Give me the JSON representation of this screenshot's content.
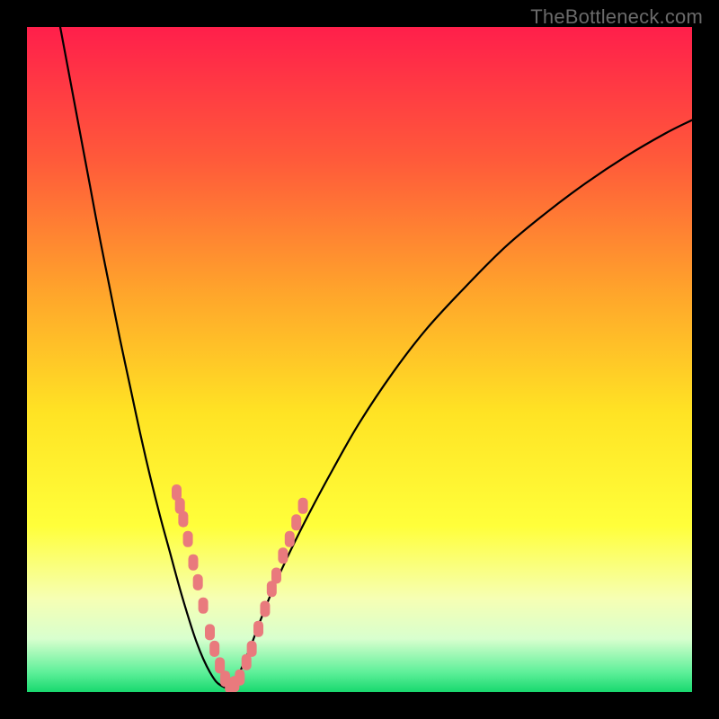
{
  "watermark": "TheBottleneck.com",
  "chart_data": {
    "type": "line",
    "title": "",
    "xlabel": "",
    "ylabel": "",
    "xlim": [
      0,
      100
    ],
    "ylim": [
      0,
      100
    ],
    "grid": false,
    "legend": false,
    "gradient_stops": [
      {
        "offset": 0.0,
        "color": "#ff1f4b"
      },
      {
        "offset": 0.2,
        "color": "#ff5a3a"
      },
      {
        "offset": 0.4,
        "color": "#ffa52b"
      },
      {
        "offset": 0.58,
        "color": "#ffe324"
      },
      {
        "offset": 0.75,
        "color": "#ffff3a"
      },
      {
        "offset": 0.86,
        "color": "#f6ffb4"
      },
      {
        "offset": 0.92,
        "color": "#d8ffce"
      },
      {
        "offset": 0.97,
        "color": "#5ff09a"
      },
      {
        "offset": 1.0,
        "color": "#18d86e"
      }
    ],
    "series": [
      {
        "name": "left-branch",
        "type": "line",
        "color": "#000000",
        "points": [
          {
            "x": 5.0,
            "y": 100.0
          },
          {
            "x": 6.5,
            "y": 92.0
          },
          {
            "x": 8.0,
            "y": 84.0
          },
          {
            "x": 9.5,
            "y": 76.0
          },
          {
            "x": 11.0,
            "y": 68.0
          },
          {
            "x": 12.5,
            "y": 60.5
          },
          {
            "x": 14.0,
            "y": 53.0
          },
          {
            "x": 15.5,
            "y": 46.0
          },
          {
            "x": 17.0,
            "y": 39.0
          },
          {
            "x": 18.5,
            "y": 32.5
          },
          {
            "x": 20.0,
            "y": 26.5
          },
          {
            "x": 21.5,
            "y": 21.0
          },
          {
            "x": 23.0,
            "y": 15.5
          },
          {
            "x": 24.5,
            "y": 10.5
          },
          {
            "x": 25.5,
            "y": 7.5
          },
          {
            "x": 26.5,
            "y": 5.0
          },
          {
            "x": 27.5,
            "y": 3.0
          },
          {
            "x": 28.5,
            "y": 1.5
          },
          {
            "x": 29.5,
            "y": 0.8
          },
          {
            "x": 30.2,
            "y": 0.5
          }
        ]
      },
      {
        "name": "right-branch",
        "type": "line",
        "color": "#000000",
        "points": [
          {
            "x": 30.2,
            "y": 0.5
          },
          {
            "x": 31.0,
            "y": 1.2
          },
          {
            "x": 32.0,
            "y": 3.0
          },
          {
            "x": 33.5,
            "y": 6.5
          },
          {
            "x": 35.0,
            "y": 10.5
          },
          {
            "x": 37.0,
            "y": 15.5
          },
          {
            "x": 39.5,
            "y": 21.0
          },
          {
            "x": 42.5,
            "y": 27.0
          },
          {
            "x": 46.0,
            "y": 33.5
          },
          {
            "x": 50.0,
            "y": 40.5
          },
          {
            "x": 55.0,
            "y": 48.0
          },
          {
            "x": 60.0,
            "y": 54.5
          },
          {
            "x": 66.0,
            "y": 61.0
          },
          {
            "x": 72.0,
            "y": 67.0
          },
          {
            "x": 78.0,
            "y": 72.0
          },
          {
            "x": 84.0,
            "y": 76.5
          },
          {
            "x": 90.0,
            "y": 80.5
          },
          {
            "x": 96.0,
            "y": 84.0
          },
          {
            "x": 100.0,
            "y": 86.0
          }
        ]
      },
      {
        "name": "highlight-markers",
        "type": "scatter",
        "color": "#e97a7d",
        "points": [
          {
            "x": 22.5,
            "y": 30.0
          },
          {
            "x": 23.0,
            "y": 28.0
          },
          {
            "x": 23.5,
            "y": 26.0
          },
          {
            "x": 24.2,
            "y": 23.0
          },
          {
            "x": 25.0,
            "y": 19.5
          },
          {
            "x": 25.7,
            "y": 16.5
          },
          {
            "x": 26.5,
            "y": 13.0
          },
          {
            "x": 27.5,
            "y": 9.0
          },
          {
            "x": 28.2,
            "y": 6.5
          },
          {
            "x": 29.0,
            "y": 4.0
          },
          {
            "x": 29.8,
            "y": 2.0
          },
          {
            "x": 30.5,
            "y": 1.0
          },
          {
            "x": 31.2,
            "y": 1.2
          },
          {
            "x": 32.0,
            "y": 2.2
          },
          {
            "x": 33.0,
            "y": 4.5
          },
          {
            "x": 33.8,
            "y": 6.5
          },
          {
            "x": 34.8,
            "y": 9.5
          },
          {
            "x": 35.8,
            "y": 12.5
          },
          {
            "x": 36.8,
            "y": 15.5
          },
          {
            "x": 37.5,
            "y": 17.5
          },
          {
            "x": 38.5,
            "y": 20.5
          },
          {
            "x": 39.5,
            "y": 23.0
          },
          {
            "x": 40.5,
            "y": 25.5
          },
          {
            "x": 41.5,
            "y": 28.0
          }
        ]
      }
    ]
  }
}
